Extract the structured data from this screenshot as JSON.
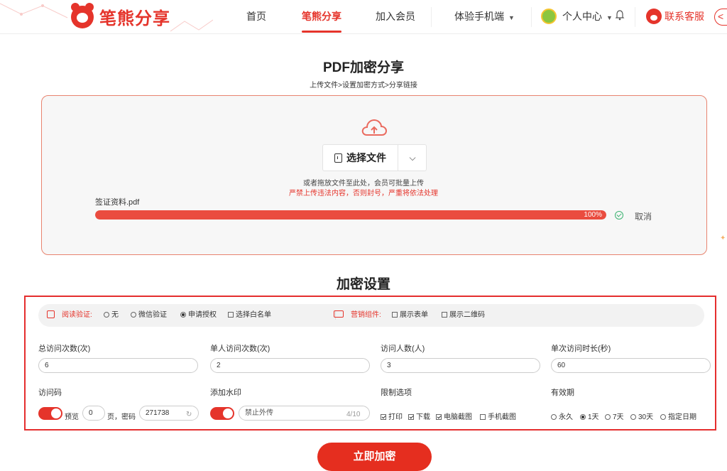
{
  "header": {
    "logo_text": "笔熊分享",
    "nav": [
      "首页",
      "笔熊分享",
      "加入会员",
      "体验手机端"
    ],
    "user_center": "个人中心",
    "service": "联系客服",
    "brand_color": "#e5342b"
  },
  "page": {
    "title": "PDF加密分享",
    "steps": "上传文件>设置加密方式>分享链接"
  },
  "upload": {
    "select_label": "选择文件",
    "drop_hint": "或者拖放文件至此处，会员可批量上传",
    "warning": "严禁上传违法内容，否则封号，严重将依法处理",
    "file_name": "签证资料.pdf",
    "progress": 1.0,
    "progress_label": "100%",
    "cancel": "取消"
  },
  "encrypt": {
    "heading": "加密设置",
    "verify_label": "阅读验证:",
    "verify_options": [
      "无",
      "微信验证",
      "申请授权",
      "选择白名单"
    ],
    "marketing_label": "营销组件:",
    "marketing_options": [
      "展示表单",
      "展示二维码"
    ],
    "fields": {
      "total_visits_label": "总访问次数(次)",
      "total_visits": "6",
      "per_user_label": "单人访问次数(次)",
      "per_user": "2",
      "visitors_label": "访问人数(人)",
      "visitors": "3",
      "duration_label": "单次访问时长(秒)",
      "duration": "60"
    },
    "access_code_label": "访问码",
    "preview_label": "预览",
    "preview_pages": "0",
    "page_pwd_label": "页，密码",
    "password": "271738",
    "watermark_label": "添加水印",
    "watermark_text": "禁止外传",
    "watermark_count": "4/10",
    "restrict_label": "限制选项",
    "restrict_options": [
      "打印",
      "下载",
      "电脑截图",
      "手机截图"
    ],
    "validity_label": "有效期",
    "validity_options": [
      "永久",
      "1天",
      "7天",
      "30天",
      "指定日期"
    ]
  },
  "submit_label": "立即加密"
}
